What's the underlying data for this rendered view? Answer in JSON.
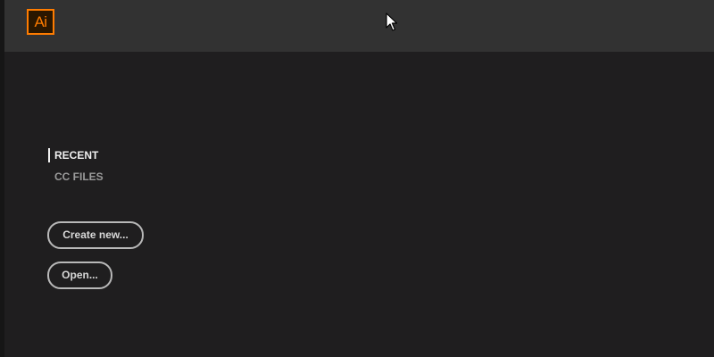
{
  "app": {
    "logo_text": "Ai",
    "accent_color": "#ff7c00"
  },
  "nav": {
    "items": [
      {
        "label": "RECENT",
        "active": true
      },
      {
        "label": "CC FILES",
        "active": false
      }
    ]
  },
  "actions": {
    "create_new_label": "Create new...",
    "open_label": "Open..."
  }
}
